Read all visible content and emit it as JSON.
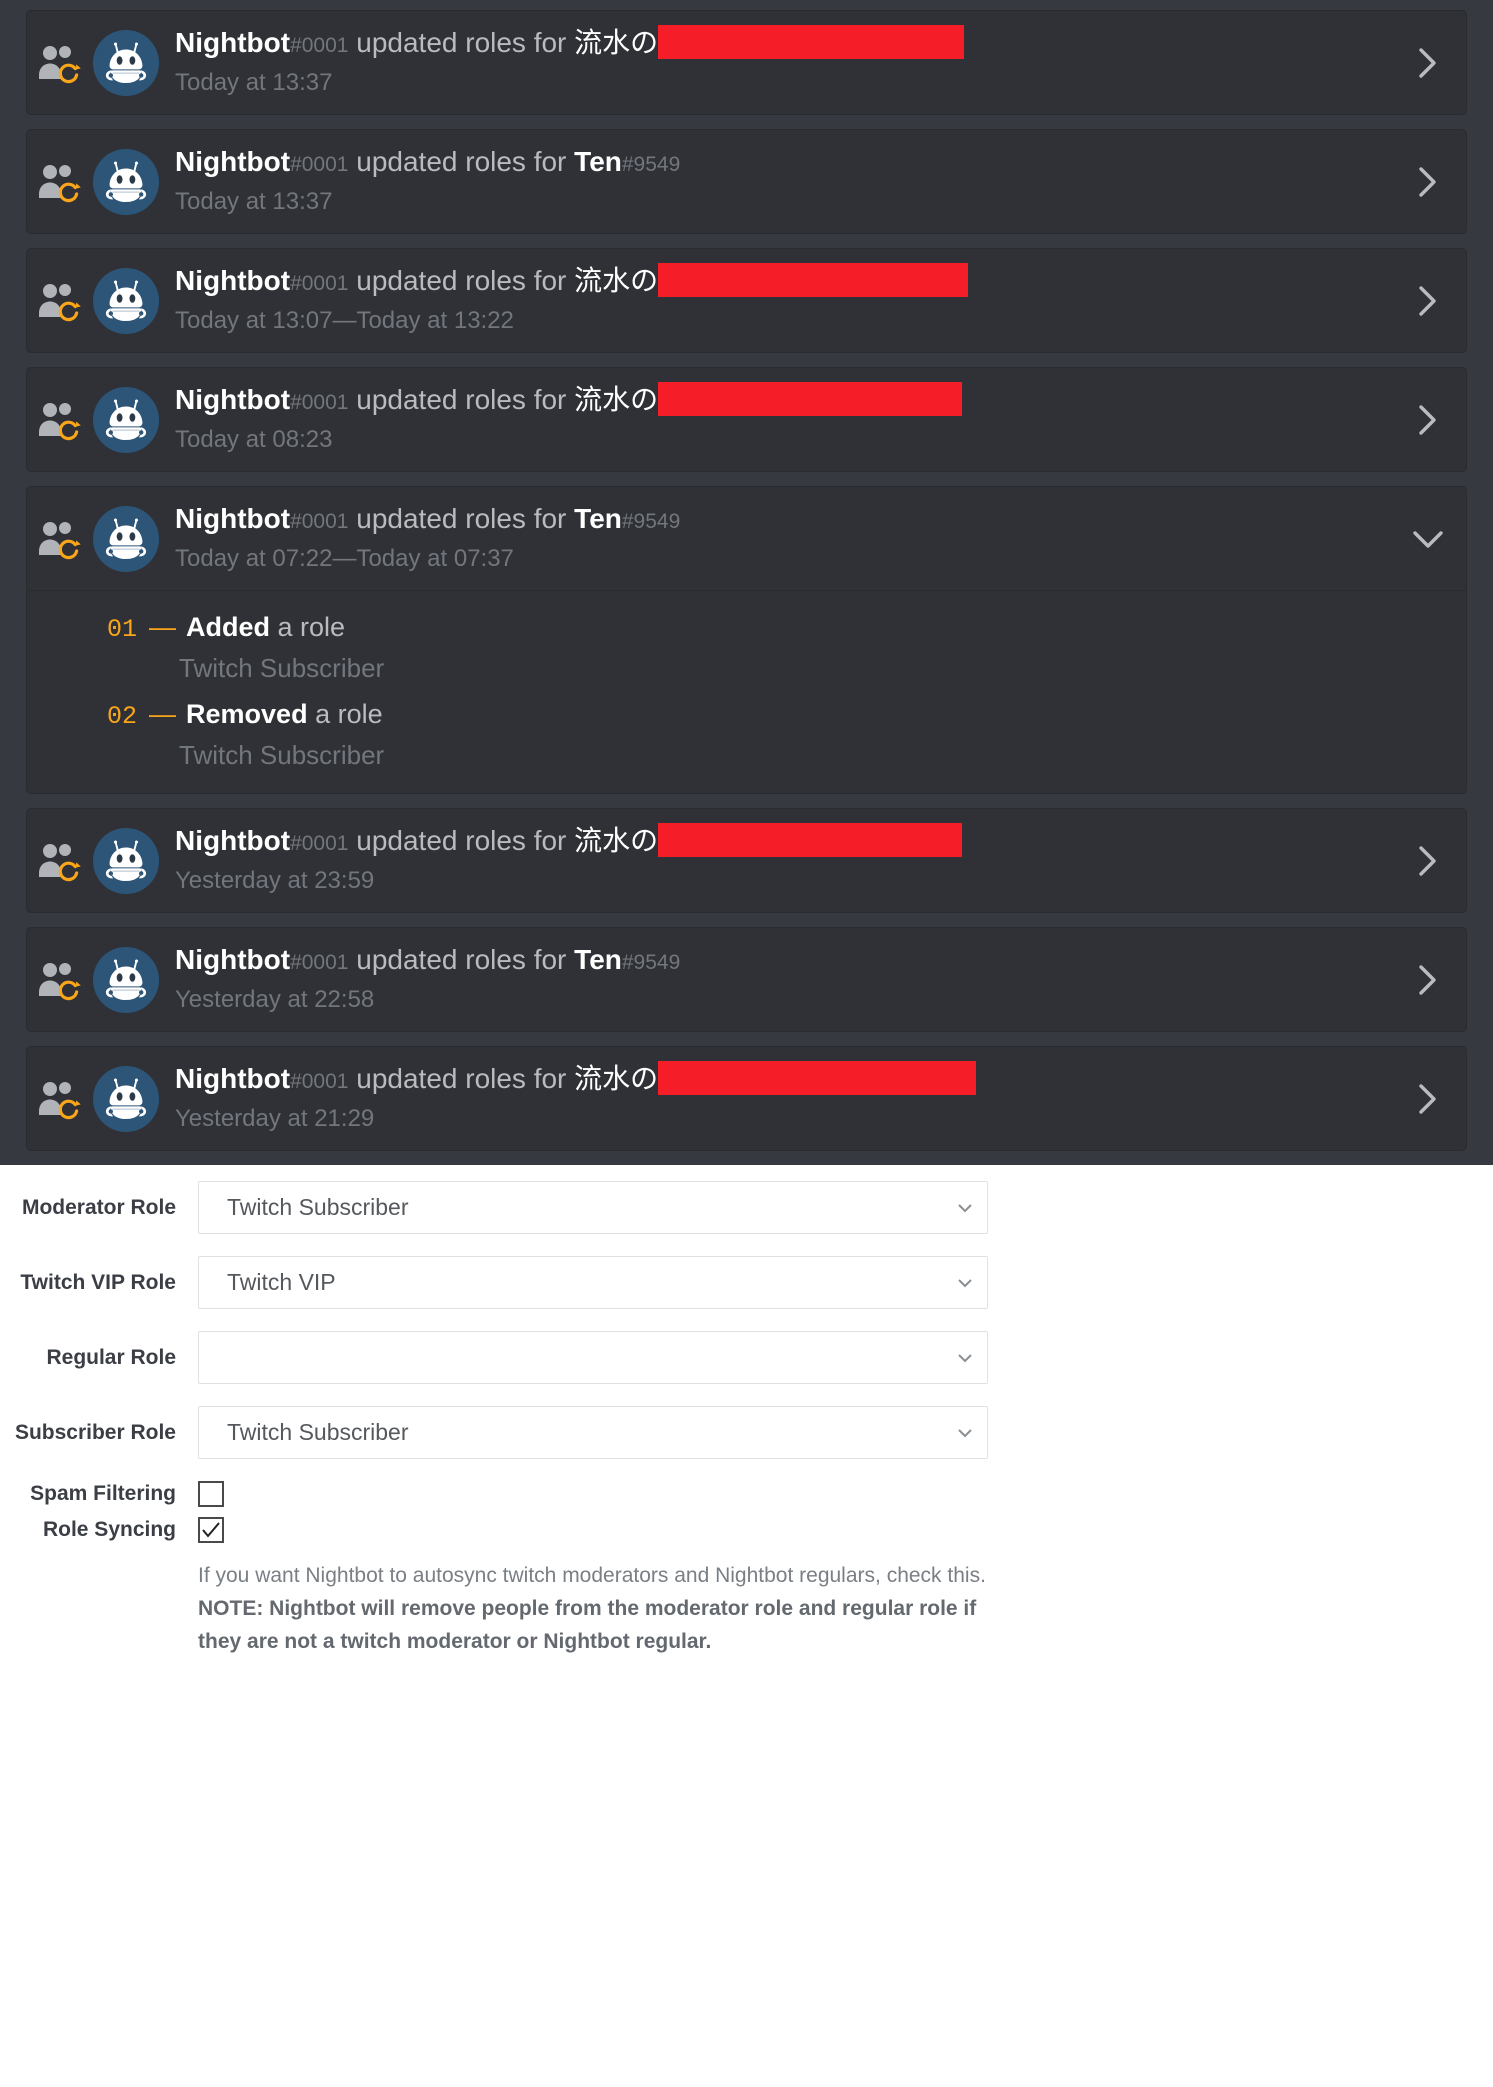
{
  "audit_log": {
    "entries": [
      {
        "icon": "members-update-icon",
        "avatar": "nightbot-avatar",
        "actor": "Nightbot",
        "discriminator": "#0001",
        "action": " updated roles for ",
        "target_visible": "流水の",
        "target_redacted": true,
        "redact_width": 306,
        "timestamp": "Today at 13:37",
        "expanded": false,
        "chevron": "chevron-right-icon",
        "changes": []
      },
      {
        "icon": "members-update-icon",
        "avatar": "nightbot-avatar",
        "actor": "Nightbot",
        "discriminator": "#0001",
        "action": " updated roles for ",
        "target_visible": "Ten",
        "target_discriminator": "#9549",
        "target_redacted": false,
        "redact_width": 0,
        "timestamp": "Today at 13:37",
        "expanded": false,
        "chevron": "chevron-right-icon",
        "changes": []
      },
      {
        "icon": "members-update-icon",
        "avatar": "nightbot-avatar",
        "actor": "Nightbot",
        "discriminator": "#0001",
        "action": " updated roles for ",
        "target_visible": "流水の",
        "target_redacted": true,
        "redact_width": 310,
        "timestamp": "Today at 13:07—Today at 13:22",
        "expanded": false,
        "chevron": "chevron-right-icon",
        "changes": []
      },
      {
        "icon": "members-update-icon",
        "avatar": "nightbot-avatar",
        "actor": "Nightbot",
        "discriminator": "#0001",
        "action": " updated roles for ",
        "target_visible": "流水の",
        "target_redacted": true,
        "redact_width": 304,
        "timestamp": "Today at 08:23",
        "expanded": false,
        "chevron": "chevron-right-icon",
        "changes": []
      },
      {
        "icon": "members-update-icon",
        "avatar": "nightbot-avatar",
        "actor": "Nightbot",
        "discriminator": "#0001",
        "action": " updated roles for ",
        "target_visible": "Ten",
        "target_discriminator": "#9549",
        "target_redacted": false,
        "redact_width": 0,
        "timestamp": "Today at 07:22—Today at 07:37",
        "expanded": true,
        "chevron": "chevron-down-icon",
        "changes": [
          {
            "index": "01",
            "dash": "—",
            "verb": "Added",
            "suffix": " a role",
            "value": "Twitch Subscriber"
          },
          {
            "index": "02",
            "dash": "—",
            "verb": "Removed",
            "suffix": " a role",
            "value": "Twitch Subscriber"
          }
        ]
      },
      {
        "icon": "members-update-icon",
        "avatar": "nightbot-avatar",
        "actor": "Nightbot",
        "discriminator": "#0001",
        "action": " updated roles for ",
        "target_visible": "流水の",
        "target_redacted": true,
        "redact_width": 304,
        "timestamp": "Yesterday at 23:59",
        "expanded": false,
        "chevron": "chevron-right-icon",
        "changes": []
      },
      {
        "icon": "members-update-icon",
        "avatar": "nightbot-avatar",
        "actor": "Nightbot",
        "discriminator": "#0001",
        "action": " updated roles for ",
        "target_visible": "Ten",
        "target_discriminator": "#9549",
        "target_redacted": false,
        "redact_width": 0,
        "timestamp": "Yesterday at 22:58",
        "expanded": false,
        "chevron": "chevron-right-icon",
        "changes": []
      },
      {
        "icon": "members-update-icon",
        "avatar": "nightbot-avatar",
        "actor": "Nightbot",
        "discriminator": "#0001",
        "action": " updated roles for ",
        "target_visible": "流水の",
        "target_redacted": true,
        "redact_width": 318,
        "timestamp": "Yesterday at 21:29",
        "expanded": false,
        "chevron": "chevron-right-icon",
        "changes": []
      }
    ]
  },
  "settings": {
    "fields": [
      {
        "label": "Moderator Role",
        "type": "select",
        "value": "Twitch Subscriber",
        "name": "moderator-role-select"
      },
      {
        "label": "Twitch VIP Role",
        "type": "select",
        "value": "Twitch VIP",
        "name": "twitch-vip-role-select"
      },
      {
        "label": "Regular Role",
        "type": "select",
        "value": "",
        "name": "regular-role-select"
      },
      {
        "label": "Subscriber Role",
        "type": "select",
        "value": "Twitch Subscriber",
        "name": "subscriber-role-select"
      }
    ],
    "spam_filtering": {
      "label": "Spam Filtering",
      "checked": false,
      "name": "spam-filtering-checkbox"
    },
    "role_syncing": {
      "label": "Role Syncing",
      "checked": true,
      "name": "role-syncing-checkbox"
    },
    "help_text_normal": "If you want Nightbot to autosync twitch moderators and Nightbot regulars, check this. ",
    "help_text_note": "NOTE: Nightbot will remove people from the moderator role and regular role if they are not a twitch moderator or Nightbot regular."
  },
  "colors": {
    "panel_bg": "#36393f",
    "entry_bg": "#2f3136",
    "redaction": "#f51d28",
    "accent_orange": "#faa61a",
    "avatar_bg": "#2c5578"
  }
}
